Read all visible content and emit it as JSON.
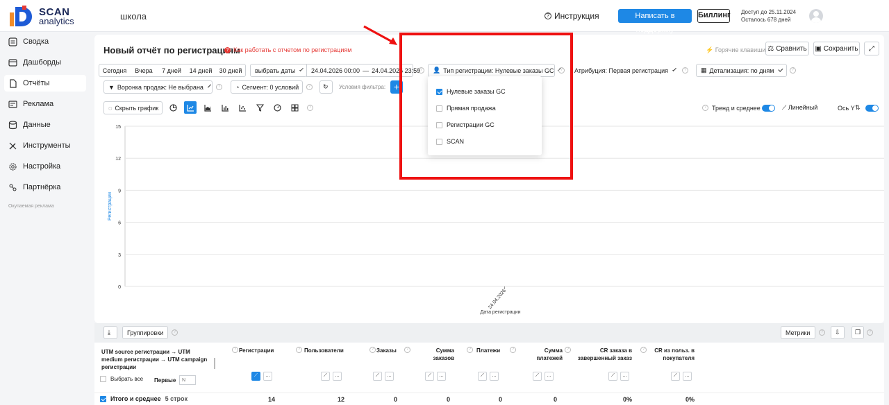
{
  "app": {
    "logo_line1": "SCAN",
    "logo_line2": "analytics",
    "project": "школа",
    "instruction": "Инструкция",
    "support_button": "Написать в поддержку",
    "billing_button": "Биллинг",
    "access_until": "Доступ до 25.11.2024",
    "days_left": "Осталось 678 дней",
    "colors": {
      "accent": "#1e88e5",
      "alert": "#e53935",
      "highlight": "#ee1111"
    }
  },
  "sidebar": {
    "items": [
      {
        "label": "Сводка",
        "icon": "summary-icon"
      },
      {
        "label": "Дашборды",
        "icon": "dashboard-icon"
      },
      {
        "label": "Отчёты",
        "icon": "reports-icon"
      },
      {
        "label": "Реклама",
        "icon": "ads-icon"
      },
      {
        "label": "Данные",
        "icon": "data-icon"
      },
      {
        "label": "Инструменты",
        "icon": "tools-icon"
      },
      {
        "label": "Настройка",
        "icon": "settings-icon"
      },
      {
        "label": "Партнёрка",
        "icon": "partner-icon"
      }
    ],
    "active_index": 2,
    "footer_note": "Окупаемая реклама"
  },
  "report": {
    "title": "Новый отчёт по регистрациям",
    "help_link": "Как работать с отчетом по регистрациям",
    "hotkeys": "Горячие клавиши",
    "compare_button": "Сравнить",
    "save_button": "Сохранить",
    "periods": [
      "Сегодня",
      "Вчера",
      "7 дней",
      "14 дней",
      "30 дней"
    ],
    "choose_dates": "выбрать даты",
    "date_from": "24.04.2026 00:00",
    "date_sep": "—",
    "date_to": "24.04.2026 23:59",
    "registration_type": "Тип регистрации: Нулевые заказы GC",
    "attribution": "Атрибуция: Первая регистрация",
    "detail": "Детализация:  по дням",
    "funnel": "Воронка продаж: Не выбрана",
    "segment": "Сегмент: 0 условий",
    "filter_conditions": "Условия фильтра:",
    "hide_chart": "Скрыть график",
    "trend_label": "Тренд и среднее",
    "linear_label": "Линейный",
    "axis_y_label": "Ось Y"
  },
  "dropdown": {
    "options": [
      {
        "label": "Нулевые заказы GC",
        "checked": true
      },
      {
        "label": "Прямая продажа",
        "checked": false
      },
      {
        "label": "Регистрации GC",
        "checked": false
      },
      {
        "label": "SCAN",
        "checked": false
      }
    ]
  },
  "chart_data": {
    "type": "line",
    "x": [
      "24.04.2026"
    ],
    "series": [],
    "ylabel": "Регистрации",
    "xlabel": "Дата регистрации",
    "ylim": [
      0,
      15
    ],
    "yticks": [
      0,
      3,
      6,
      9,
      12,
      15
    ],
    "grid": true
  },
  "table": {
    "groupings_button": "Группировки",
    "metrics_button": "Метрики",
    "group_header": "UTM source регистрации → UTM medium регистрации → UTM campaign регистрации",
    "select_all": "Выбрать все",
    "first_label": "Первые",
    "first_placeholder": "N",
    "columns": [
      "Регистрации",
      "Пользователи",
      "Заказы",
      "Сумма заказов",
      "Платежи",
      "Сумма платежей",
      "CR заказа в завершенный заказ",
      "CR из польз. в покупателя"
    ],
    "total_label": "Итого и среднее",
    "total_rows": "5 строк",
    "totals": [
      "14",
      "12",
      "0",
      "0",
      "0",
      "0",
      "0%",
      "0%"
    ]
  }
}
